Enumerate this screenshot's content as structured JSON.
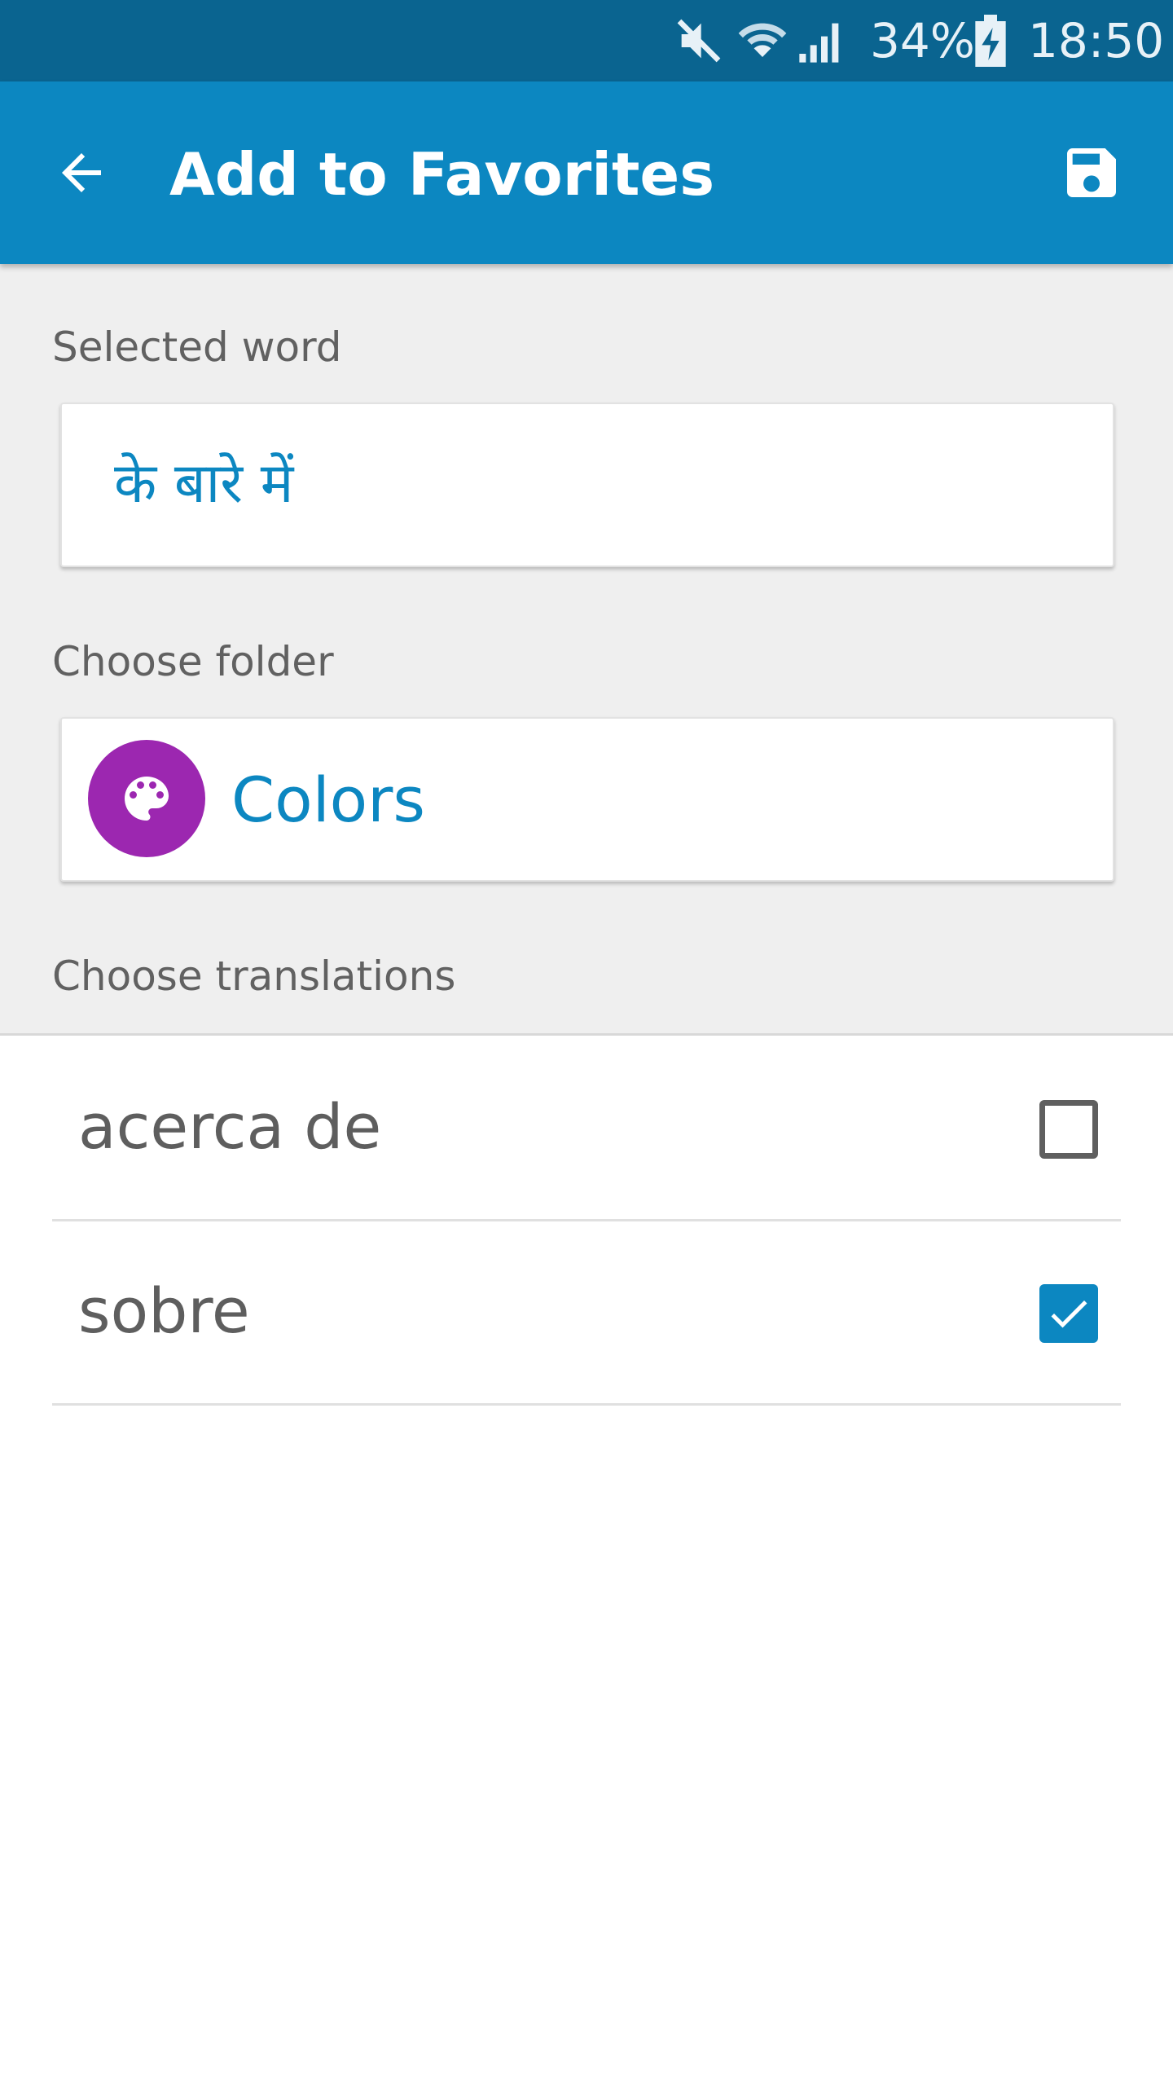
{
  "status_bar": {
    "battery_percent": "34%",
    "time": "18:50",
    "icons": [
      "mute-icon",
      "wifi-icon",
      "signal-icon",
      "battery-charging-icon"
    ]
  },
  "app_bar": {
    "title": "Add to Favorites",
    "back_icon": "arrow-back-icon",
    "save_icon": "save-floppy-icon",
    "background_color": "#0c87c1"
  },
  "form": {
    "selected_word_label": "Selected word",
    "selected_word_value": "के बारे में",
    "choose_folder_label": "Choose folder",
    "folder": {
      "name": "Colors",
      "icon": "palette-icon",
      "icon_background": "#9c27b0"
    },
    "choose_translations_label": "Choose translations"
  },
  "translations": [
    {
      "text": "acerca de",
      "checked": false
    },
    {
      "text": "sobre",
      "checked": true
    }
  ],
  "colors": {
    "accent": "#0c87c1",
    "status_bar": "#0a6490"
  }
}
